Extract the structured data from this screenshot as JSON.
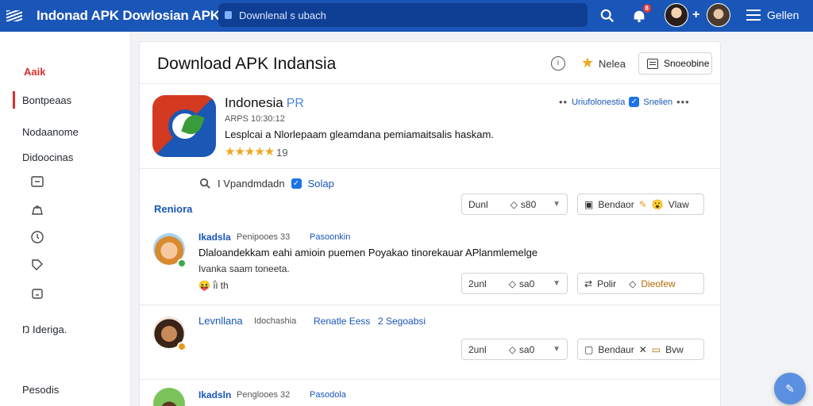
{
  "header": {
    "app_title": "Indonad APK Dowlosian APK",
    "search_placeholder": "Downlenal s ubach",
    "notification_count": "8",
    "user_label": "Gellen"
  },
  "sidebar": {
    "brand": "Aaik",
    "items": [
      {
        "label": "Bontpeaas",
        "active": true
      },
      {
        "label": "Nodaanome"
      },
      {
        "label": "Didoocinas"
      }
    ],
    "icons": [
      "window-icon",
      "bag-icon",
      "clock-icon",
      "tag-icon",
      "box-icon"
    ],
    "settings_label": "Ideriga.",
    "settings_prefix": "Ŋ",
    "footer_label": "Pesodis"
  },
  "page": {
    "title": "Download APK Indansia",
    "rate_label": "Nelea",
    "subscribe_label": "Snoeobine"
  },
  "app": {
    "name": "Indonesia",
    "name_tag": "PR",
    "version": "ARPS 10:30:12",
    "description": "Lesplcai a Nlorlepaam gleamdana pemiamaitsalis haskam.",
    "stars": "★★★★★",
    "rating_count": "19",
    "meta_link": "Uriufolonestia",
    "meta_status": "Snelien"
  },
  "reviews": {
    "filter_label": "I Vpandmdadn",
    "filter_check": "Solap",
    "section_label": "Reniora",
    "top_controls": {
      "select_value": "Dunl",
      "select_count": "s80",
      "action_label": "Bendaor",
      "action_tail": "Vlaw"
    },
    "items": [
      {
        "name": "Ikadsla",
        "meta": "Penipooes 33",
        "tag": "Pasoonkin",
        "text": "Dlaloandekkam eahi amioin puemen Poyakao tinorekauar APlanmlemelge",
        "sub": "Ivanka saam toneeta.",
        "reactions": "😝 ḯi th",
        "select_value": "2unl",
        "select_count": "sa0",
        "action_label": "Polir",
        "action_tail": "Dieofew"
      },
      {
        "name": "Levnllana",
        "meta": "Idochashia",
        "tag": "Renatle Eess",
        "tag2": "2 Segoabsi",
        "select_value": "2unl",
        "select_count": "sa0",
        "action_label": "Bendaur",
        "action_tail": "Bvw"
      },
      {
        "name": "Ikadsln",
        "meta": "Penglooes 32",
        "tag": "Pasodola"
      }
    ]
  },
  "colors": {
    "topbar": "#1a56b8",
    "accent_red": "#d9302c",
    "link_blue": "#1a56b8",
    "star": "#f0a622"
  }
}
